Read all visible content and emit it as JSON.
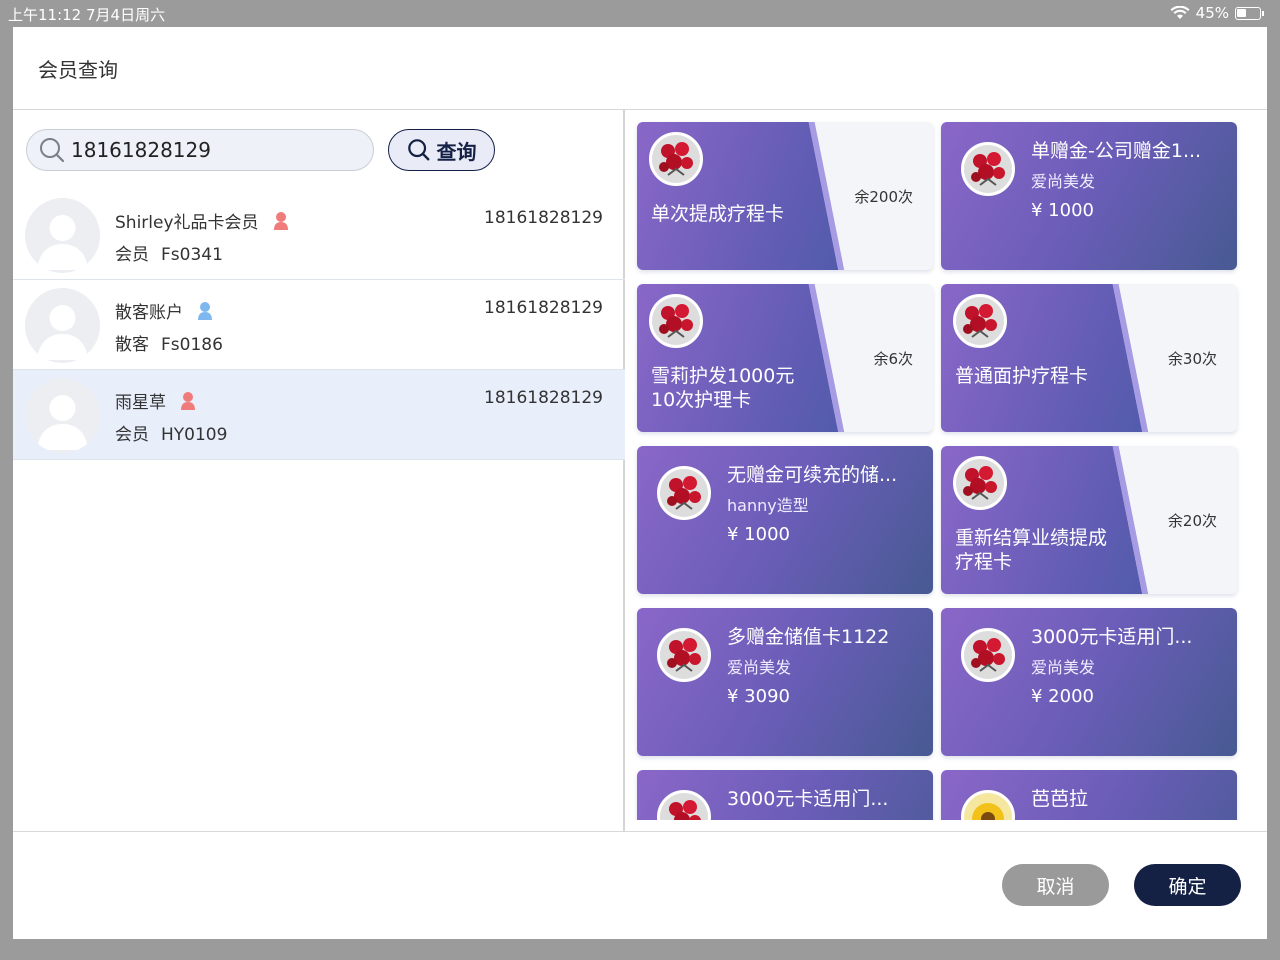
{
  "status_bar": {
    "time_date": "上午11:12   7月4日周六",
    "battery": "45%"
  },
  "dialog": {
    "title": "会员查询"
  },
  "search": {
    "value": "18161828129",
    "button_label": "查询"
  },
  "members": [
    {
      "name": "Shirley礼品卡会员",
      "type": "会员",
      "code": "Fs0341",
      "phone": "18161828129",
      "gender_color": "#f07b7b"
    },
    {
      "name": "散客账户",
      "type": "散客",
      "code": "Fs0186",
      "phone": "18161828129",
      "gender_color": "#7fb8ef"
    },
    {
      "name": "雨星草",
      "type": "会员",
      "code": "HY0109",
      "phone": "18161828129",
      "gender_color": "#f07b7b"
    }
  ],
  "cards": [
    {
      "kind": "treatment",
      "title_line1": "单次提成疗程卡",
      "title_line2": "",
      "remaining": "余200次"
    },
    {
      "kind": "stored",
      "title": "单赠金-公司赠金1...",
      "store": "爱尚美发",
      "amount": "¥ 1000"
    },
    {
      "kind": "treatment",
      "title_line1": "雪莉护发1000元",
      "title_line2": "10次护理卡",
      "remaining": "余6次"
    },
    {
      "kind": "treatment",
      "title_line1": "普通面护疗程卡",
      "title_line2": "",
      "remaining": "余30次"
    },
    {
      "kind": "stored",
      "title": "无赠金可续充的储...",
      "store": "hanny造型",
      "amount": "¥ 1000"
    },
    {
      "kind": "treatment",
      "title_line1": "重新结算业绩提成",
      "title_line2": "疗程卡",
      "remaining": "余20次"
    },
    {
      "kind": "stored",
      "title": "多赠金储值卡1122",
      "store": "爱尚美发",
      "amount": "¥ 3090"
    },
    {
      "kind": "stored",
      "title": "3000元卡适用门...",
      "store": "爱尚美发",
      "amount": "¥ 2000"
    },
    {
      "kind": "stored",
      "title": "3000元卡适用门...",
      "store": "",
      "amount": ""
    },
    {
      "kind": "stored",
      "title": "芭芭拉",
      "store": "",
      "amount": ""
    }
  ],
  "footer": {
    "cancel_label": "取消",
    "confirm_label": "确定"
  },
  "colors": {
    "accent_dark": "#142044",
    "card_purple": "#7a62c2",
    "card_blue": "#475a92"
  }
}
